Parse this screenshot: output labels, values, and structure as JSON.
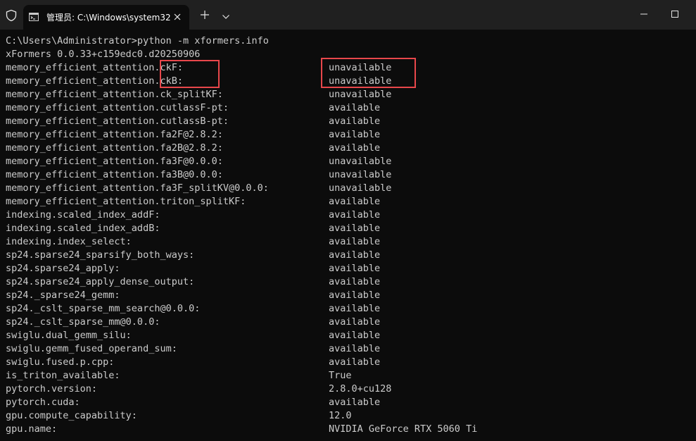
{
  "tab": {
    "title": "管理员: C:\\Windows\\system32",
    "tab_icon": "terminal-icon"
  },
  "icons": {
    "shield": "shield-icon",
    "close": "close-icon",
    "new_tab": "plus-icon",
    "dropdown": "chevron-down-icon",
    "minimize": "minimize-icon",
    "maximize": "maximize-icon"
  },
  "colors": {
    "background": "#0c0c0c",
    "titlebar": "#202020",
    "text": "#cccccc",
    "highlight": "#e8474b"
  },
  "terminal": {
    "command": "C:\\Users\\Administrator>python -m xformers.info",
    "version": "xFormers 0.0.33+c159edc0.d20250906",
    "rows": [
      {
        "key": "memory_efficient_attention.ckF:",
        "value": "unavailable"
      },
      {
        "key": "memory_efficient_attention.ckB:",
        "value": "unavailable"
      },
      {
        "key": "memory_efficient_attention.ck_splitKF:",
        "value": "unavailable"
      },
      {
        "key": "memory_efficient_attention.cutlassF-pt:",
        "value": "available"
      },
      {
        "key": "memory_efficient_attention.cutlassB-pt:",
        "value": "available"
      },
      {
        "key": "memory_efficient_attention.fa2F@2.8.2:",
        "value": "available"
      },
      {
        "key": "memory_efficient_attention.fa2B@2.8.2:",
        "value": "available"
      },
      {
        "key": "memory_efficient_attention.fa3F@0.0.0:",
        "value": "unavailable"
      },
      {
        "key": "memory_efficient_attention.fa3B@0.0.0:",
        "value": "unavailable"
      },
      {
        "key": "memory_efficient_attention.fa3F_splitKV@0.0.0:",
        "value": "unavailable"
      },
      {
        "key": "memory_efficient_attention.triton_splitKF:",
        "value": "available"
      },
      {
        "key": "indexing.scaled_index_addF:",
        "value": "available"
      },
      {
        "key": "indexing.scaled_index_addB:",
        "value": "available"
      },
      {
        "key": "indexing.index_select:",
        "value": "available"
      },
      {
        "key": "sp24.sparse24_sparsify_both_ways:",
        "value": "available"
      },
      {
        "key": "sp24.sparse24_apply:",
        "value": "available"
      },
      {
        "key": "sp24.sparse24_apply_dense_output:",
        "value": "available"
      },
      {
        "key": "sp24._sparse24_gemm:",
        "value": "available"
      },
      {
        "key": "sp24._cslt_sparse_mm_search@0.0.0:",
        "value": "available"
      },
      {
        "key": "sp24._cslt_sparse_mm@0.0.0:",
        "value": "available"
      },
      {
        "key": "swiglu.dual_gemm_silu:",
        "value": "available"
      },
      {
        "key": "swiglu.gemm_fused_operand_sum:",
        "value": "available"
      },
      {
        "key": "swiglu.fused.p.cpp:",
        "value": "available"
      },
      {
        "key": "is_triton_available:",
        "value": "True"
      },
      {
        "key": "pytorch.version:",
        "value": "2.8.0+cu128"
      },
      {
        "key": "pytorch.cuda:",
        "value": "available"
      },
      {
        "key": "gpu.compute_capability:",
        "value": "12.0"
      },
      {
        "key": "gpu.name:",
        "value": "NVIDIA GeForce RTX 5060 Ti"
      }
    ]
  }
}
